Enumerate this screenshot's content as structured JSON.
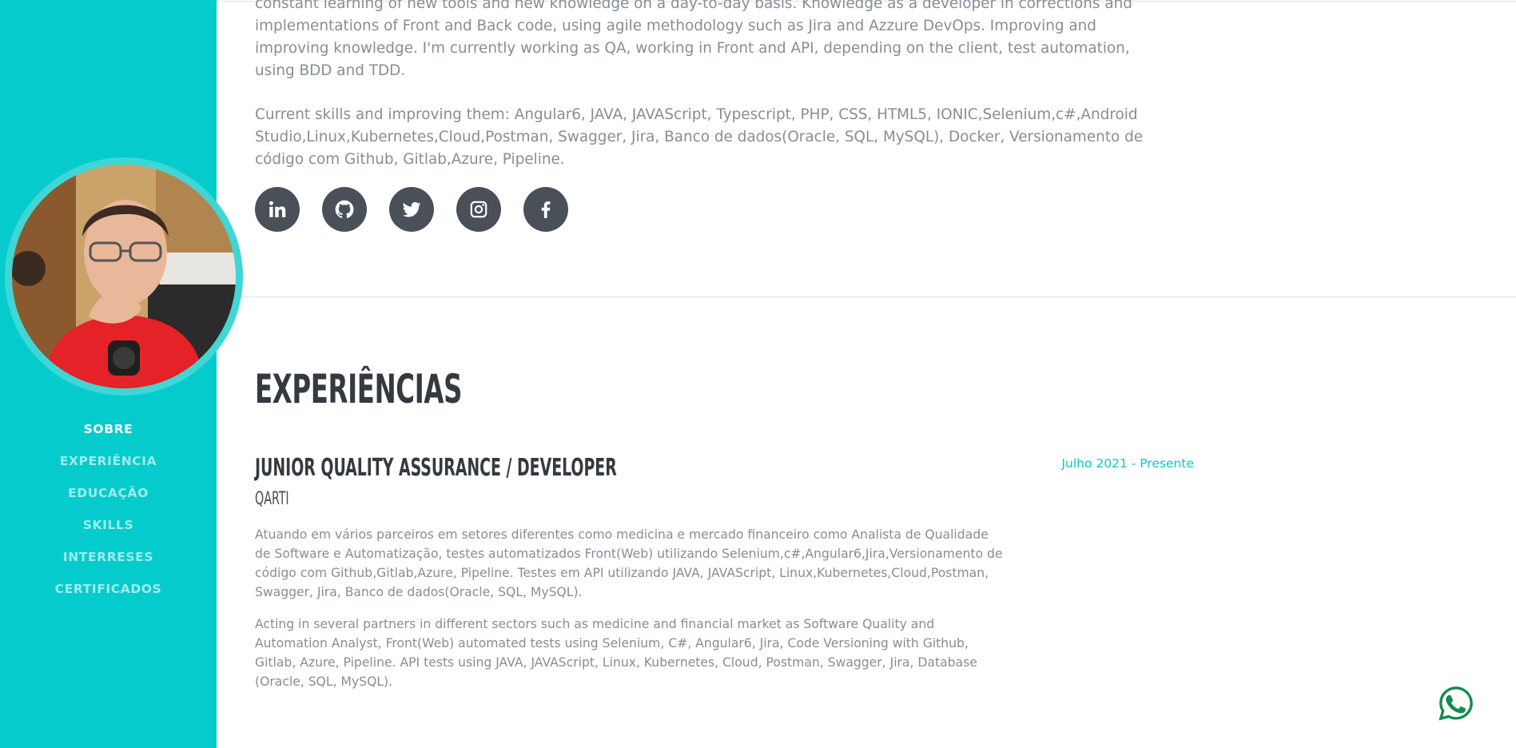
{
  "about": {
    "paragraph_1": "constant learning of new tools and new knowledge on a day-to-day basis. Knowledge as a developer in corrections and implementations of Front and Back code, using agile methodology such as Jira and Azzure DevOps. Improving and improving knowledge. I'm currently working as QA, working in Front and API, depending on the client, test automation, using BDD and TDD.",
    "paragraph_2": "Current skills and improving them: Angular6, JAVA, JAVAScript, Typescript, PHP, CSS, HTML5, IONIC,Selenium,c#,Android Studio,Linux,Kubernetes,Cloud,Postman, Swagger, Jira, Banco de dados(Oracle, SQL, MySQL), Docker, Versionamento de código com Github, Gitlab,Azure, Pipeline."
  },
  "socials": [
    {
      "icon": "linkedin-icon"
    },
    {
      "icon": "github-icon"
    },
    {
      "icon": "twitter-icon"
    },
    {
      "icon": "instagram-icon"
    },
    {
      "icon": "facebook-icon"
    }
  ],
  "sidebar": {
    "items": [
      {
        "label": "SOBRE",
        "active": true
      },
      {
        "label": "EXPERIÊNCIA",
        "active": false
      },
      {
        "label": "EDUCAÇÃO",
        "active": false
      },
      {
        "label": "SKILLS",
        "active": false
      },
      {
        "label": "INTERRESES",
        "active": false
      },
      {
        "label": "CERTIFICADOS",
        "active": false
      }
    ]
  },
  "experience": {
    "section_title": "Experiências",
    "job": {
      "title": "Junior Quality Assurance / Developer",
      "company": "QARTI",
      "date": "Julho 2021 - Presente",
      "description_pt": "Atuando em vários parceiros em setores diferentes como medicina e mercado financeiro como Analista de Qualidade de Software e Automatização, testes automatizados Front(Web) utilizando Selenium,c#,Angular6,Jira,Versionamento de código com Github,Gitlab,Azure, Pipeline. Testes em API utilizando JAVA, JAVAScript, Linux,Kubernetes,Cloud,Postman, Swagger, Jira, Banco de dados(Oracle, SQL, MySQL).",
      "description_en": "Acting in several partners in different sectors such as medicine and financial market as Software Quality and Automation Analyst, Front(Web) automated tests using Selenium, C#, Angular6, Jira, Code Versioning with Github, Gitlab, Azure, Pipeline. API tests using JAVA, JAVAScript, Linux, Kubernetes, Cloud, Postman, Swagger, Jira, Database (Oracle, SQL, MySQL)."
    }
  },
  "colors": {
    "primary": "#06cbcc",
    "dark": "#343a40",
    "text": "#868e96",
    "social_bg": "#495057",
    "whatsapp": "#128c4b"
  },
  "widgets": {
    "whatsapp_icon": "whatsapp-icon"
  }
}
